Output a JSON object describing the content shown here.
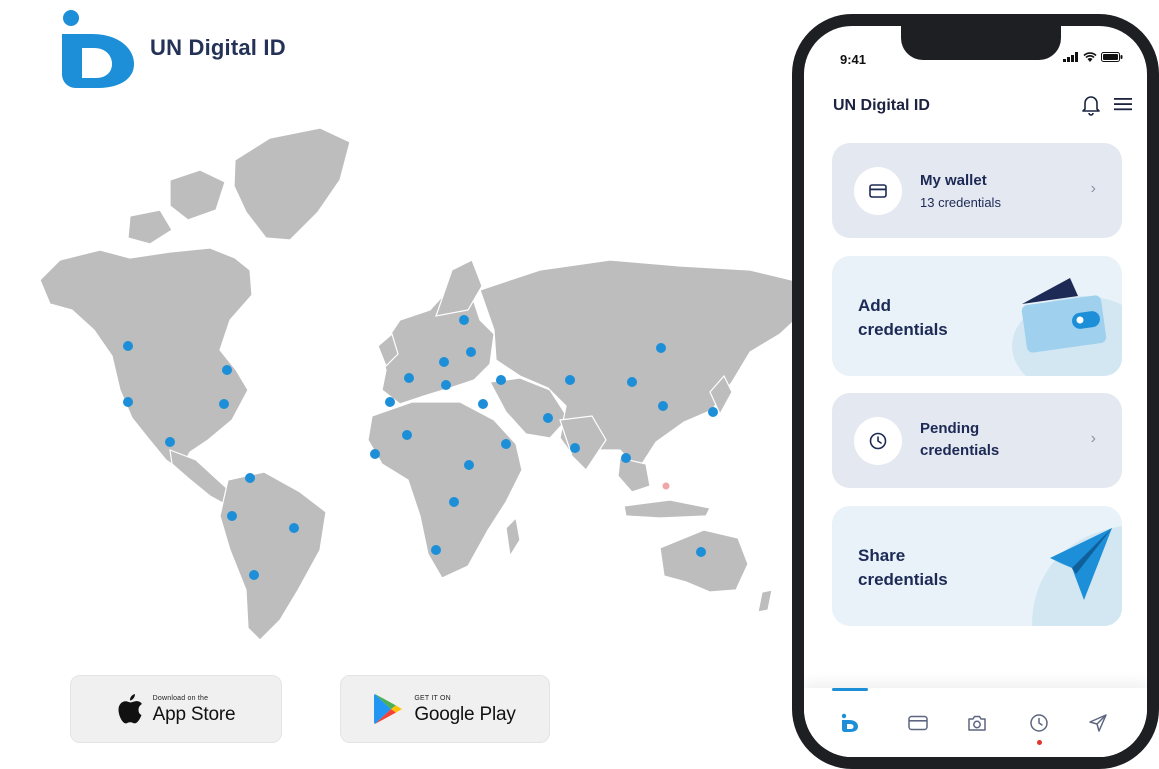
{
  "brand": {
    "name": "UN Digital ID",
    "logo": "un-digital-id-logo",
    "accent": "#1c8fd8"
  },
  "map": {
    "land_color": "#bdbdbd",
    "marker_color": "#1c8fd8",
    "highlight_marker_color": "#f0a6a6"
  },
  "stores": {
    "apple": {
      "small": "Download on the",
      "big": "App Store",
      "icon": "apple-icon"
    },
    "google": {
      "small": "GET IT ON",
      "big": "Google Play",
      "icon": "google-play-icon"
    }
  },
  "phone": {
    "status": {
      "time": "9:41"
    },
    "header": {
      "title": "UN Digital ID",
      "bell_icon": "bell-icon",
      "menu_icon": "menu-icon"
    },
    "cards": {
      "wallet": {
        "title": "My wallet",
        "subtitle": "13 credentials",
        "icon": "wallet-card-icon"
      },
      "add": {
        "line1": "Add",
        "line2": "credentials",
        "icon": "wallet-illustration"
      },
      "pending": {
        "line1": "Pending",
        "line2": "credentials",
        "icon": "clock-icon"
      },
      "share": {
        "line1": "Share",
        "line2": "credentials",
        "icon": "paper-plane-illustration"
      }
    },
    "tabbar": {
      "tabs": [
        "home-id-icon",
        "wallet-icon",
        "camera-icon",
        "history-clock-icon",
        "send-icon"
      ],
      "active": "home-id-icon",
      "notification_color": "#e0352b"
    }
  }
}
